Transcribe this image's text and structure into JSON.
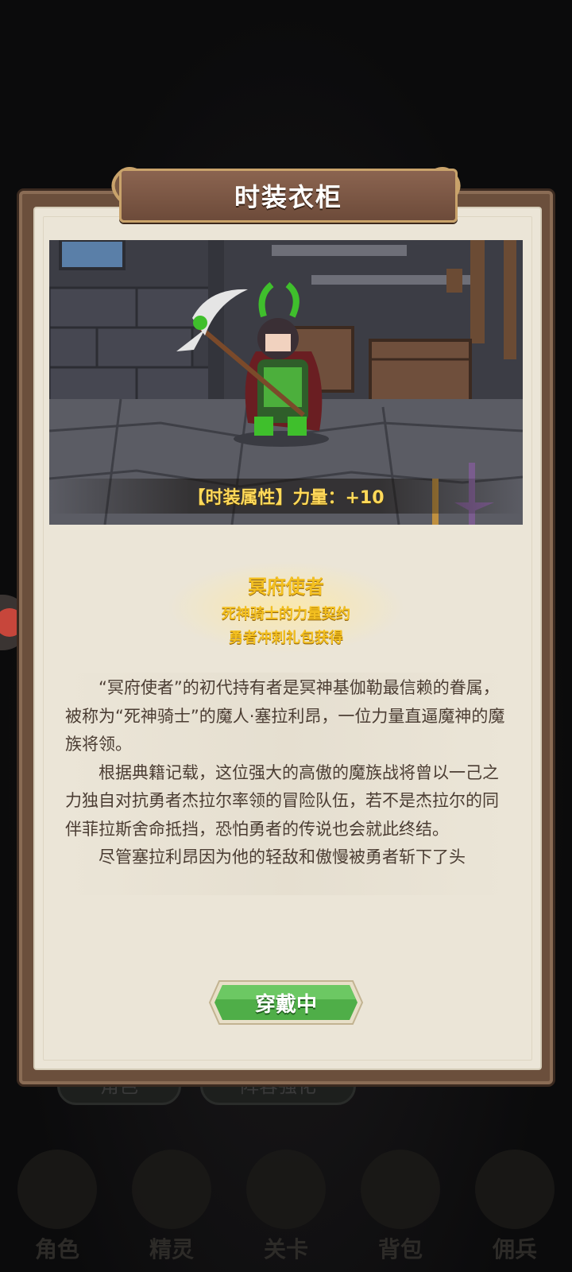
{
  "background": {
    "tabs": [
      "角色",
      "阵容强化"
    ],
    "nav": [
      "角色",
      "精灵",
      "关卡",
      "背包",
      "佣兵"
    ]
  },
  "modal": {
    "title": "时装衣柜",
    "attribute_label": "【时装属性】力量：+10",
    "costume": {
      "name": "冥府使者",
      "subtitle": "死神骑士的力量契约",
      "source": "勇者冲刺礼包获得"
    },
    "description": [
      "“冥府使者”的初代持有者是冥神基伽勒最信赖的眷属，被称为“死神骑士”的魔人·塞拉利昂，一位力量直逼魔神的魔族将领。",
      "根据典籍记载，这位强大的高傲的魔族战将曾以一己之力独自对抗勇者杰拉尔率领的冒险队伍，若不是杰拉尔的同伴菲拉斯舍命抵挡，恐怕勇者的传说也会就此终结。",
      "尽管塞拉利昂因为他的轻敌和傲慢被勇者斩下了头"
    ],
    "wear_button": "穿戴中"
  },
  "colors": {
    "frame": "#6b4f3c",
    "panel": "#ebe5d7",
    "gold_text": "#f4c020",
    "button_green": "#4fae48"
  }
}
